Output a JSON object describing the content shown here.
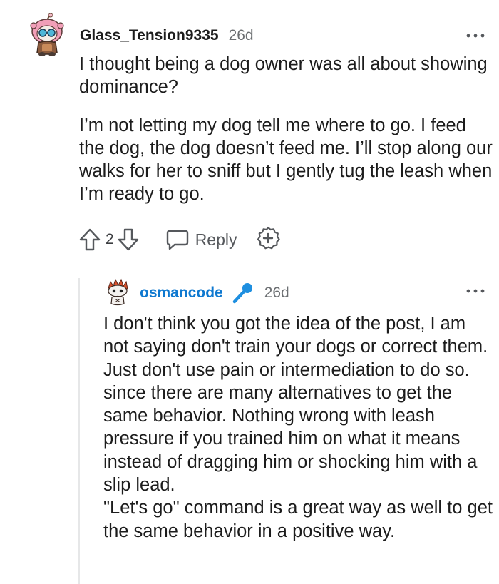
{
  "comment": {
    "username": "Glass_Tension9335",
    "time": "26d",
    "paragraphs": [
      "I thought being a dog owner was all about showing dominance?",
      "I’m not letting my dog tell me where to go. I feed the dog, the dog doesn’t feed me. I’ll stop along our walks for her to sniff but I gently tug the leash when I’m ready to go."
    ],
    "score": "2",
    "reply_label": "Reply",
    "icons": {
      "avatar": "snoo-avatar-pink-hood",
      "more": "more-options-icon",
      "upvote": "upvote-arrow-icon",
      "downvote": "downvote-arrow-icon",
      "reply": "reply-bubble-icon",
      "award": "award-plus-icon"
    }
  },
  "reply": {
    "username": "osmancode",
    "time": "26d",
    "lines": [
      "I don't think you got the idea of the post, I am not saying don't train your dogs or correct them. Just don't use pain or intermediation to do so. since there are many alternatives to get the same behavior. Nothing wrong with leash pressure if you trained him on what it means instead of dragging him or shocking him with a slip lead.",
      "\"Let's go\" command is a great way as well to get the same behavior in a positive way."
    ],
    "icons": {
      "avatar": "snoo-avatar-red-hair",
      "badge": "microphone-icon",
      "more": "more-options-icon"
    }
  },
  "colors": {
    "username_reply": "#0f79d0",
    "text": "#1c1c1c",
    "meta": "#6c6f72",
    "thread_line": "#e6e7e8",
    "mic": "#1e8fe0"
  }
}
